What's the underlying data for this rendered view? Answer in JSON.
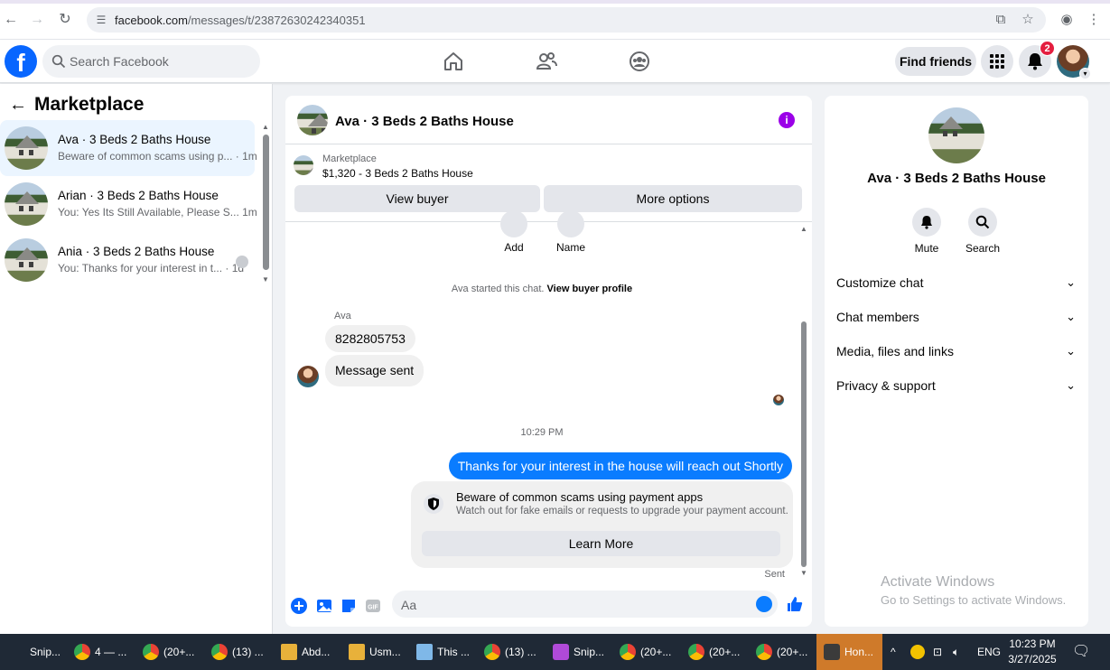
{
  "browser": {
    "url_host": "facebook.com",
    "url_path": "/messages/t/23872630242340351"
  },
  "fb_header": {
    "search_placeholder": "Search Facebook",
    "find_friends_label": "Find friends",
    "notification_count": "2"
  },
  "left_panel": {
    "title": "Marketplace",
    "conversations": [
      {
        "name": "Ava · 3 Beds 2 Baths House",
        "snippet": "Beware of common scams using p... · 1m",
        "active": true
      },
      {
        "name": "Arian · 3 Beds 2 Baths House",
        "snippet": "You: Yes Its Still Available, Please S...  1m",
        "active": false
      },
      {
        "name": "Ania · 3 Beds 2 Baths House",
        "snippet": "You: Thanks for your interest in t... · 1d",
        "active": false
      }
    ]
  },
  "chat": {
    "title": "Ava · 3 Beds 2 Baths House",
    "marketplace_label": "Marketplace",
    "listing_price": "$1,320 - 3 Beds 2 Baths House",
    "view_buyer_label": "View buyer",
    "more_options_label": "More options",
    "add_label": "Add",
    "name_label": "Name",
    "started_text": "Ava started this chat.",
    "view_buyer_profile": "View buyer profile",
    "sender_name": "Ava",
    "message_1": "8282805753",
    "message_2": "Message sent",
    "timestamp": "10:29 PM",
    "outgoing_message": "Thanks for your interest in the house will reach out Shortly",
    "scam_title": "Beware of common scams using payment apps",
    "scam_subtitle": "Watch out for fake emails or requests to upgrade your payment account.",
    "learn_more_label": "Learn More",
    "sent_status": "Sent",
    "composer_placeholder": "Aa"
  },
  "details": {
    "title": "Ava · 3 Beds 2 Baths House",
    "mute_label": "Mute",
    "search_label": "Search",
    "rows": [
      "Customize chat",
      "Chat members",
      "Media, files and links",
      "Privacy & support"
    ]
  },
  "watermark": {
    "line1": "Activate Windows",
    "line2": "Go to Settings to activate Windows."
  },
  "taskbar": {
    "items": [
      "Snip...",
      "4 — ...",
      "(20+...",
      "(13) ...",
      "Abd...",
      "Usm...",
      "This ...",
      "(13) ...",
      "Snip...",
      "(20+...",
      "(20+...",
      "(20+...",
      "Hon..."
    ],
    "language": "ENG",
    "time": "10:23 PM",
    "date": "3/27/2025"
  },
  "colors": {
    "fb_blue": "#0866ff",
    "message_blue": "#0a7cff",
    "info_purple": "#9b00e8",
    "active_conv_bg": "#ebf5ff"
  }
}
